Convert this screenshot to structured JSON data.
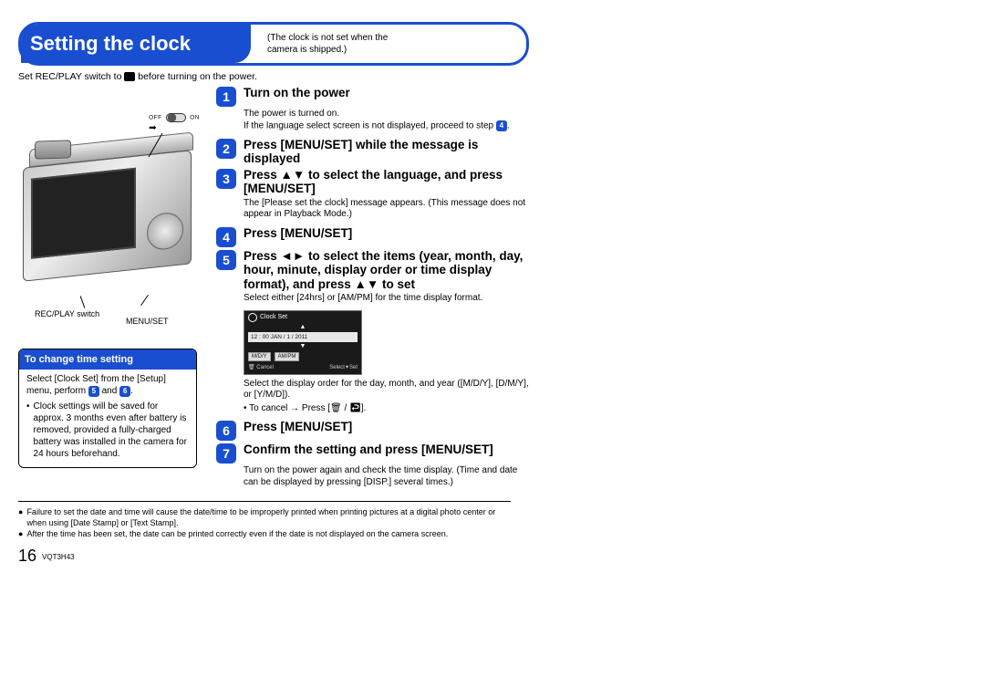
{
  "header": {
    "title": "Setting the clock",
    "subtitle_line1": "(The clock is not set when the",
    "subtitle_line2": "camera is shipped.)"
  },
  "intro_pre": "Set REC/PLAY switch to ",
  "intro_post": " before turning on the power.",
  "camera_labels": {
    "off": "OFF",
    "on": "ON",
    "recplay": "REC/PLAY switch",
    "menuset": "MENU/SET"
  },
  "info_box": {
    "title": "To change time setting",
    "line1_pre": "Select [Clock Set] from the [Setup] menu, perform ",
    "line1_mid": " and ",
    "line1_end": ".",
    "badge5": "5",
    "badge6": "6",
    "bullet": "Clock settings will be saved for approx. 3 months even after battery is removed, provided a fully-charged battery was installed in the camera for 24 hours beforehand."
  },
  "steps": [
    {
      "n": "1",
      "title": "Turn on the power",
      "body_line1": "The power is turned on.",
      "body_line2_pre": "If the language select screen is not displayed, proceed to step ",
      "body_step_badge": "4",
      "body_line2_post": "."
    },
    {
      "n": "2",
      "title": "Press [MENU/SET] while the message is displayed"
    },
    {
      "n": "3",
      "title": "Press ▲▼ to select the language, and press [MENU/SET]",
      "body": "The [Please set the clock] message appears. (This message does not appear in Playback Mode.)"
    },
    {
      "n": "4",
      "title": "Press [MENU/SET]"
    },
    {
      "n": "5",
      "title": "Press ◄► to select the items (year, month, day, hour, minute, display order or time display format), and press ▲▼ to set",
      "body": "Select either [24hrs] or [AM/PM] for the time display format."
    },
    {
      "n": "6",
      "title": "Press [MENU/SET]"
    },
    {
      "n": "7",
      "title": "Confirm the setting and press [MENU/SET]",
      "body": "Turn on the power again and check the time display. (Time and date can be displayed by pressing [DISP.] several times.)"
    }
  ],
  "clockset_ui": {
    "title": "Clock Set",
    "row_date": "12 : 00   JAN / 1 / 2011",
    "btn1": "M/D/Y",
    "btn2": "AM/PM",
    "foot_cancel": "Cancel",
    "foot_select": "Select",
    "foot_set": "Set"
  },
  "after_ui_note": "Select the display order for the day, month, and year ([M/D/Y], [D/M/Y], or [Y/M/D]).",
  "after_ui_bullet": "To cancel → Press [🗑 / ↩].",
  "footnotes": [
    "Failure to set the date and time will cause the date/time to be improperly printed when printing pictures at a digital photo center or when using [Date Stamp] or [Text Stamp].",
    "After the time has been set, the date can be printed correctly even if the date is not displayed on the camera screen."
  ],
  "page_number": "16",
  "page_code": "VQT3H43"
}
